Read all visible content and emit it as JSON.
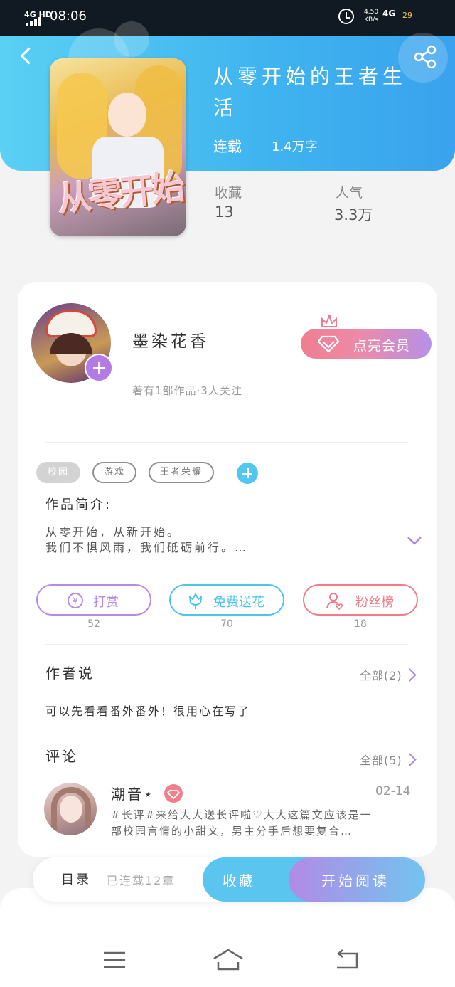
{
  "status_bar": {
    "signal": "4G HD",
    "time": "08:06",
    "speed_value": "4.50",
    "speed_unit": "KB/s",
    "network": "4G",
    "battery": "29"
  },
  "book": {
    "title_line1": "从零开始的王者生",
    "title_line2": "活",
    "status": "连载",
    "words": "1.4万字",
    "cover_text": "从零开始",
    "stats": [
      {
        "label": "收藏",
        "value": "13"
      },
      {
        "label": "人气",
        "value": "3.3万"
      }
    ]
  },
  "author": {
    "name": "墨染花香",
    "meta": "著有1部作品·3人关注",
    "vip_button": "点亮会员"
  },
  "tags": [
    "校园",
    "游戏",
    "王者荣耀"
  ],
  "intro": {
    "title": "作品简介:",
    "line1": "从零开始，从新开始。",
    "line2": "我们不惧风雨，我们砥砺前行。…"
  },
  "actions": [
    {
      "label": "打赏",
      "count": "52",
      "color": "#b58be6"
    },
    {
      "label": "免费送花",
      "count": "70",
      "color": "#4fc4ea"
    },
    {
      "label": "粉丝榜",
      "count": "18",
      "color": "#ef7c86"
    }
  ],
  "author_says": {
    "title": "作者说",
    "all": "全部(2)",
    "text": "可以先看看番外番外！很用心在写了"
  },
  "comments": {
    "title": "评论",
    "all": "全部(5)",
    "items": [
      {
        "user": "潮音⋆",
        "date": "02-14",
        "line1": "#长评#来给大大送长评啦♡大大这篇文应该是一",
        "line2": "部校园言情的小甜文，男主分手后想要复合…"
      }
    ]
  },
  "bottom_bar": {
    "toc": "目录",
    "toc_count": "已连载12章",
    "favorite": "收藏",
    "start_reading": "开始阅读"
  }
}
